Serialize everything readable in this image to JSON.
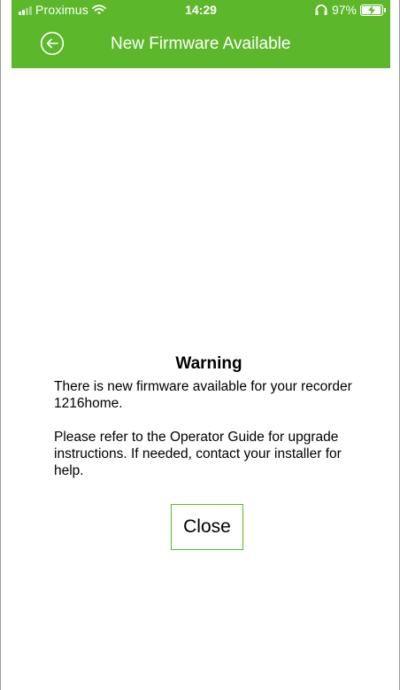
{
  "status_bar": {
    "carrier": "Proximus",
    "time": "14:29",
    "battery_percent": "97%",
    "battery_level": 0.97,
    "icons": [
      "signal-icon",
      "wifi-icon",
      "headphones-icon",
      "battery-icon",
      "charging-bolt-icon"
    ]
  },
  "header": {
    "title": "New Firmware Available",
    "back_icon": "back-arrow-circle-icon"
  },
  "dialog": {
    "title": "Warning",
    "paragraph1": "There is new firmware available for your recorder 1216home.",
    "paragraph2": "Please refer to the Operator Guide for upgrade instructions. If needed, contact your installer for help.",
    "close_label": "Close"
  },
  "colors": {
    "accent": "#5cb82a",
    "background": "#ffffff",
    "text": "#000000"
  }
}
